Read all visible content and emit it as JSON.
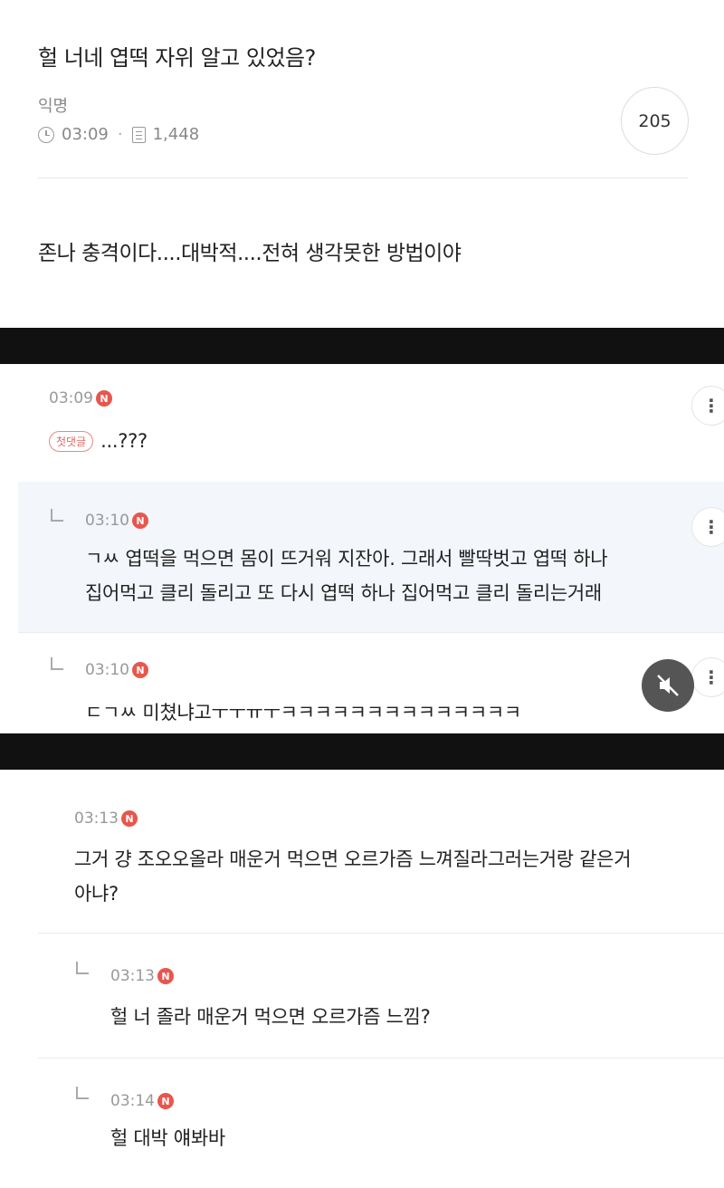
{
  "post": {
    "title": "헐 너네 엽떡 자위 알고 있었음?",
    "author": "익명",
    "time": "03:09",
    "views": "1,448",
    "comment_count": "205",
    "body": "존나 충격이다....대박적....전혀 생각못한 방법이야"
  },
  "comments_block1": [
    {
      "time": "03:09",
      "badge": "첫댓글",
      "text": "...???"
    },
    {
      "time": "03:10",
      "text_line1": "ㄱㅆ 엽떡을 먹으면 몸이 뜨거워 지잔아. 그래서 빨딱벗고 엽떡 하나",
      "text_line2": "집어먹고 클리 돌리고 또 다시 엽떡 하나 집어먹고 클리 돌리는거래"
    },
    {
      "time": "03:10",
      "text": "ㄷㄱㅆ 미쳤냐고ㅜㅜㅠㅜㅋㅋㅋㅋㅋㅋㅋㅋㅋㅋㅋㅋㅋㅋ"
    }
  ],
  "comments_block2": [
    {
      "time": "03:13",
      "text_line1": "그거 걍 조오오올라 매운거 먹으면 오르가즘 느껴질라그러는거랑 같은거",
      "text_line2": "아냐?"
    },
    {
      "time": "03:13",
      "text": "헐 너 졸라 매운거 먹으면 오르가즘 느낌?"
    },
    {
      "time": "03:14",
      "text": "헐 대박 얘봐바"
    }
  ],
  "n_badge": "N",
  "more_icon": "⋮",
  "colors": {
    "accent": "#e8564c",
    "reply_bg": "#f3f6fb",
    "band": "#111111"
  }
}
